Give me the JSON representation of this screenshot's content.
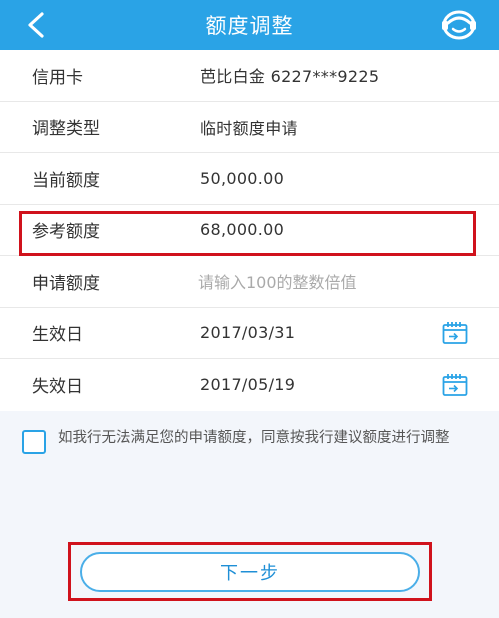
{
  "header": {
    "title": "额度调整",
    "back_icon": "chevron-left-icon",
    "service_icon": "customer-service-icon"
  },
  "form": {
    "credit_card": {
      "label": "信用卡",
      "value": "芭比白金  6227***9225"
    },
    "adjust_type": {
      "label": "调整类型",
      "value": "临时额度申请"
    },
    "current_limit": {
      "label": "当前额度",
      "value": "50,000.00"
    },
    "reference_limit": {
      "label": "参考额度",
      "value": "68,000.00"
    },
    "apply_limit": {
      "label": "申请额度",
      "placeholder": "请输入100的整数倍值",
      "value": ""
    },
    "effective_date": {
      "label": "生效日",
      "value": "2017/03/31",
      "icon": "calendar-icon"
    },
    "expiry_date": {
      "label": "失效日",
      "value": "2017/05/19",
      "icon": "calendar-icon"
    }
  },
  "agreement": {
    "checked": false,
    "text": "如我行无法满足您的申请额度，同意按我行建议额度进行调整"
  },
  "actions": {
    "next_label": "下一步"
  },
  "colors": {
    "header_bg": "#2aa3e6",
    "highlight": "#d0121c",
    "button_text": "#1f8fd6"
  }
}
